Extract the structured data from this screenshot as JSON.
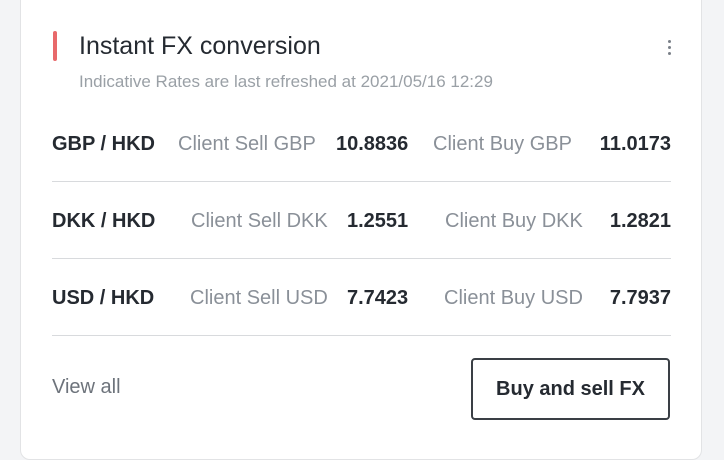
{
  "card": {
    "title": "Instant FX conversion",
    "subtitle": "Indicative Rates are last refreshed at 2021/05/16 12:29",
    "accent_color": "#e8696b",
    "menu_icon": "more-vertical-icon"
  },
  "rates": [
    {
      "pair": "GBP / HKD",
      "sell_label": "Client Sell GBP",
      "sell_value": "10.8836",
      "buy_label": "Client Buy GBP",
      "buy_value": "11.0173"
    },
    {
      "pair": "DKK / HKD",
      "sell_label": "Client Sell DKK",
      "sell_value": "1.2551",
      "buy_label": "Client Buy DKK",
      "buy_value": "1.2821"
    },
    {
      "pair": "USD / HKD",
      "sell_label": "Client Sell USD",
      "sell_value": "7.7423",
      "buy_label": "Client Buy USD",
      "buy_value": "7.7937"
    }
  ],
  "footer": {
    "view_all": "View all",
    "cta": "Buy and sell FX"
  }
}
